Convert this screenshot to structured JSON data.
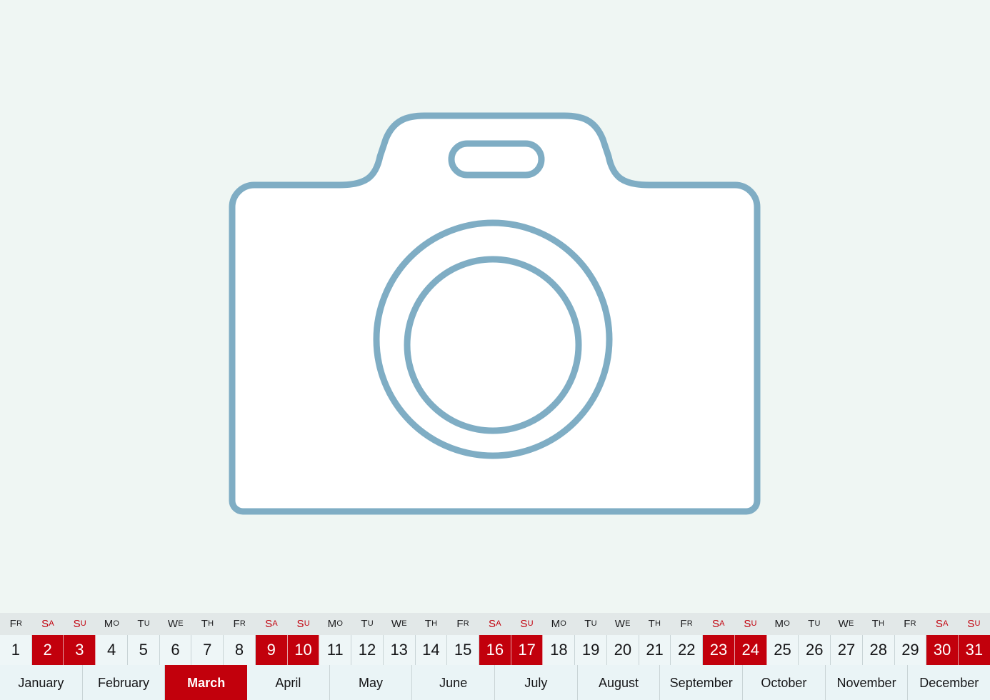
{
  "page": {
    "background_color": "#eff6f3",
    "accent_red": "#c2000c",
    "stroke_blue": "#7fadc4"
  },
  "hero": {
    "icon_name": "camera-icon",
    "stroke_color": "#7fadc4",
    "fill_color": "#ffffff",
    "parts": [
      "camera-body",
      "camera-top-hump",
      "viewfinder-pill",
      "lens-outer-ring",
      "lens-inner-ring"
    ]
  },
  "calendar": {
    "weekdays": [
      {
        "first": "F",
        "rest": "R",
        "weekend": false
      },
      {
        "first": "S",
        "rest": "A",
        "weekend": true
      },
      {
        "first": "S",
        "rest": "U",
        "weekend": true
      },
      {
        "first": "M",
        "rest": "O",
        "weekend": false
      },
      {
        "first": "T",
        "rest": "U",
        "weekend": false
      },
      {
        "first": "W",
        "rest": "E",
        "weekend": false
      },
      {
        "first": "T",
        "rest": "H",
        "weekend": false
      },
      {
        "first": "F",
        "rest": "R",
        "weekend": false
      },
      {
        "first": "S",
        "rest": "A",
        "weekend": true
      },
      {
        "first": "S",
        "rest": "U",
        "weekend": true
      },
      {
        "first": "M",
        "rest": "O",
        "weekend": false
      },
      {
        "first": "T",
        "rest": "U",
        "weekend": false
      },
      {
        "first": "W",
        "rest": "E",
        "weekend": false
      },
      {
        "first": "T",
        "rest": "H",
        "weekend": false
      },
      {
        "first": "F",
        "rest": "R",
        "weekend": false
      },
      {
        "first": "S",
        "rest": "A",
        "weekend": true
      },
      {
        "first": "S",
        "rest": "U",
        "weekend": true
      },
      {
        "first": "M",
        "rest": "O",
        "weekend": false
      },
      {
        "first": "T",
        "rest": "U",
        "weekend": false
      },
      {
        "first": "W",
        "rest": "E",
        "weekend": false
      },
      {
        "first": "T",
        "rest": "H",
        "weekend": false
      },
      {
        "first": "F",
        "rest": "R",
        "weekend": false
      },
      {
        "first": "S",
        "rest": "A",
        "weekend": true
      },
      {
        "first": "S",
        "rest": "U",
        "weekend": true
      },
      {
        "first": "M",
        "rest": "O",
        "weekend": false
      },
      {
        "first": "T",
        "rest": "U",
        "weekend": false
      },
      {
        "first": "W",
        "rest": "E",
        "weekend": false
      },
      {
        "first": "T",
        "rest": "H",
        "weekend": false
      },
      {
        "first": "F",
        "rest": "R",
        "weekend": false
      },
      {
        "first": "S",
        "rest": "A",
        "weekend": true
      },
      {
        "first": "S",
        "rest": "U",
        "weekend": true
      }
    ],
    "days": [
      {
        "num": "1",
        "weekend": false
      },
      {
        "num": "2",
        "weekend": true
      },
      {
        "num": "3",
        "weekend": true
      },
      {
        "num": "4",
        "weekend": false
      },
      {
        "num": "5",
        "weekend": false
      },
      {
        "num": "6",
        "weekend": false
      },
      {
        "num": "7",
        "weekend": false
      },
      {
        "num": "8",
        "weekend": false
      },
      {
        "num": "9",
        "weekend": true
      },
      {
        "num": "10",
        "weekend": true
      },
      {
        "num": "11",
        "weekend": false
      },
      {
        "num": "12",
        "weekend": false
      },
      {
        "num": "13",
        "weekend": false
      },
      {
        "num": "14",
        "weekend": false
      },
      {
        "num": "15",
        "weekend": false
      },
      {
        "num": "16",
        "weekend": true
      },
      {
        "num": "17",
        "weekend": true
      },
      {
        "num": "18",
        "weekend": false
      },
      {
        "num": "19",
        "weekend": false
      },
      {
        "num": "20",
        "weekend": false
      },
      {
        "num": "21",
        "weekend": false
      },
      {
        "num": "22",
        "weekend": false
      },
      {
        "num": "23",
        "weekend": true
      },
      {
        "num": "24",
        "weekend": true
      },
      {
        "num": "25",
        "weekend": false
      },
      {
        "num": "26",
        "weekend": false
      },
      {
        "num": "27",
        "weekend": false
      },
      {
        "num": "28",
        "weekend": false
      },
      {
        "num": "29",
        "weekend": false
      },
      {
        "num": "30",
        "weekend": true
      },
      {
        "num": "31",
        "weekend": true
      }
    ],
    "months": [
      {
        "name": "January",
        "current": false
      },
      {
        "name": "February",
        "current": false
      },
      {
        "name": "March",
        "current": true
      },
      {
        "name": "April",
        "current": false
      },
      {
        "name": "May",
        "current": false
      },
      {
        "name": "June",
        "current": false
      },
      {
        "name": "July",
        "current": false
      },
      {
        "name": "August",
        "current": false
      },
      {
        "name": "September",
        "current": false
      },
      {
        "name": "October",
        "current": false
      },
      {
        "name": "November",
        "current": false
      },
      {
        "name": "December",
        "current": false
      }
    ]
  }
}
